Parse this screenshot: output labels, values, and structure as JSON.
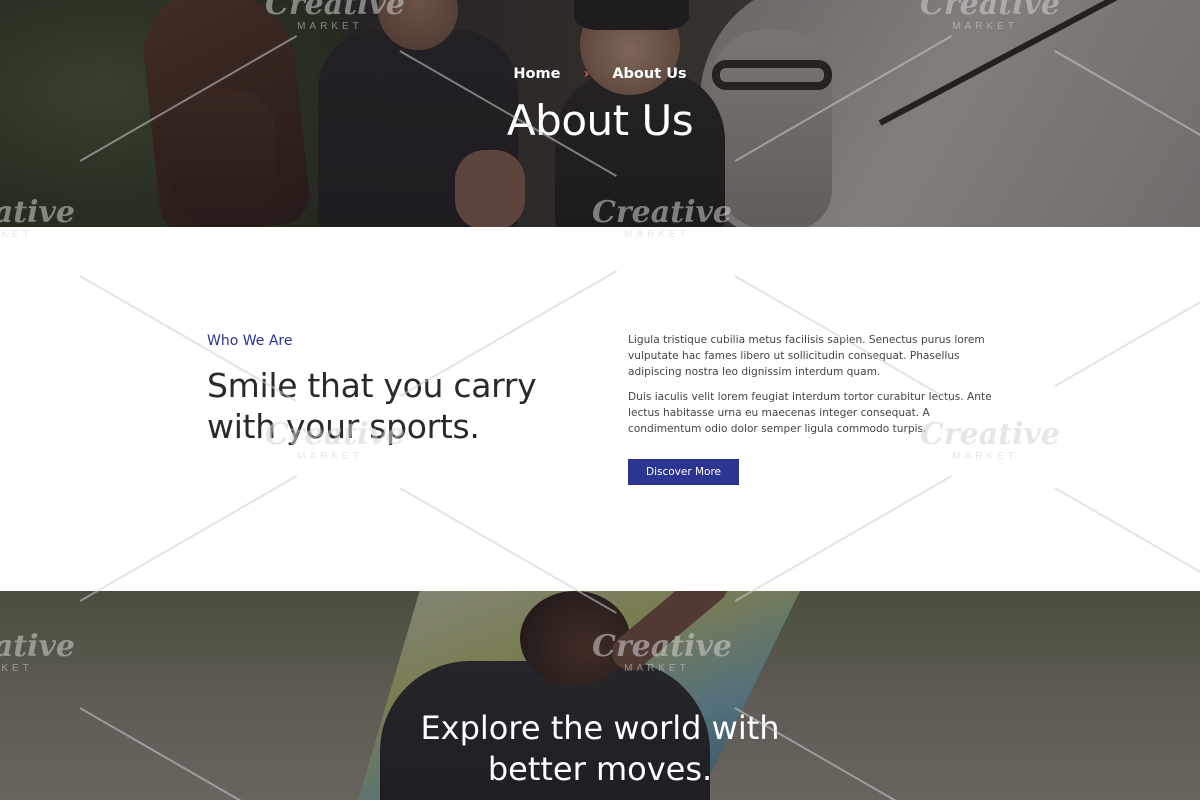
{
  "hero": {
    "breadcrumb": {
      "home": "Home",
      "separator": "›",
      "current": "About Us"
    },
    "title": "About Us"
  },
  "about": {
    "eyebrow": "Who We Are",
    "headline": "Smile that you carry with your sports.",
    "paragraphs": [
      "Ligula tristique cubilia metus facilisis sapien. Senectus purus lorem vulputate hac fames libero ut sollicitudin consequat. Phasellus adipiscing nostra leo dignissim interdum quam.",
      "Duis iaculis velit lorem feugiat interdum tortor curabitur lectus. Ante lectus habitasse urna eu maecenas integer consequat. A condimentum odio dolor semper ligula commodo turpis."
    ],
    "button_label": "Discover More"
  },
  "banner": {
    "title": "Explore the world with better moves."
  },
  "watermark": {
    "word": "Creative",
    "sub": "MARKET"
  },
  "colors": {
    "accent": "#2c3592",
    "breadcrumb_separator": "#e4572e",
    "heading": "#2a2a2a"
  }
}
